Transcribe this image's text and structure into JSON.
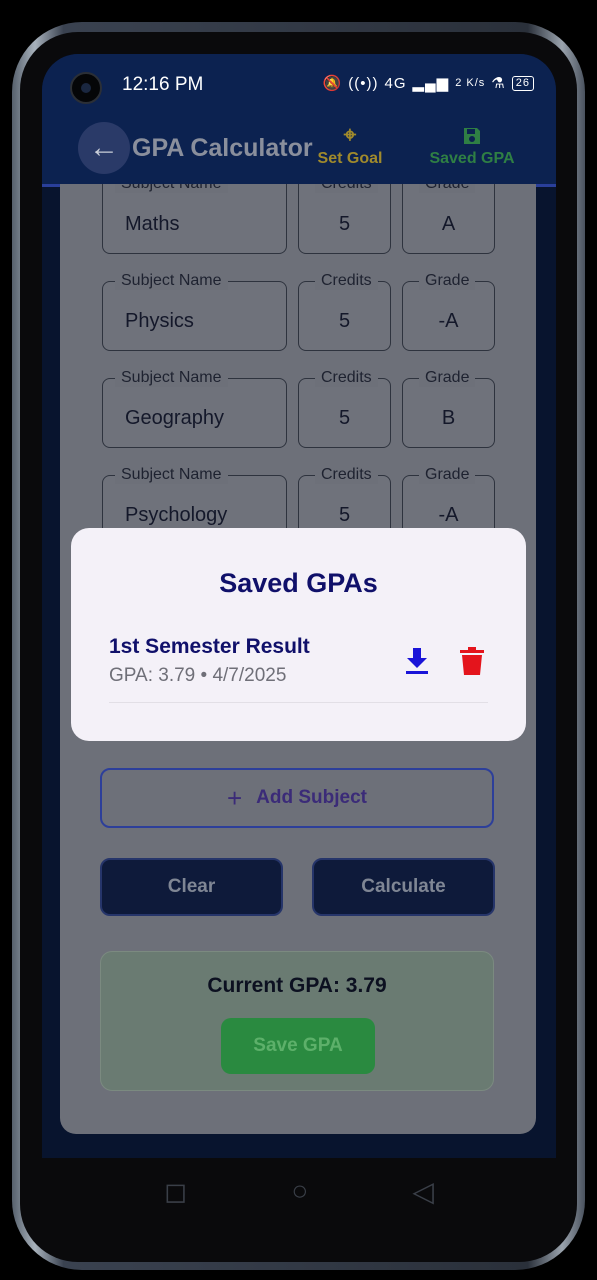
{
  "status_bar": {
    "time": "12:16 PM",
    "network": "4G",
    "speed": "2 K/s",
    "battery": "26"
  },
  "app_bar": {
    "title": "GPA Calculator",
    "set_goal": "Set Goal",
    "saved_gpa": "Saved GPA"
  },
  "labels": {
    "subject": "Subject Name",
    "credits": "Credits",
    "grade": "Grade"
  },
  "subjects": [
    {
      "name": "Maths",
      "credits": "5",
      "grade": "A"
    },
    {
      "name": "Physics",
      "credits": "5",
      "grade": "-A"
    },
    {
      "name": "Geography",
      "credits": "5",
      "grade": "B"
    },
    {
      "name": "Psychology",
      "credits": "5",
      "grade": "-A"
    }
  ],
  "add_subject": "Add Subject",
  "buttons": {
    "clear": "Clear",
    "calculate": "Calculate"
  },
  "result": {
    "text": "Current GPA: 3.79",
    "save": "Save GPA"
  },
  "dialog": {
    "title": "Saved GPAs",
    "items": [
      {
        "name": "1st Semester Result",
        "meta": "GPA: 3.79 • 4/7/2025"
      }
    ]
  },
  "colors": {
    "primary": "#0c2250",
    "accent_blue": "#10106a",
    "delete_red": "#e4141c",
    "download_blue": "#1a14d8",
    "save_green": "#2a8a40"
  },
  "icons": {
    "back": "arrow-left-icon",
    "goal": "crosshair-icon",
    "saved": "floppy-disk-icon",
    "download": "download-icon",
    "delete": "trash-icon",
    "add": "plus-icon"
  }
}
